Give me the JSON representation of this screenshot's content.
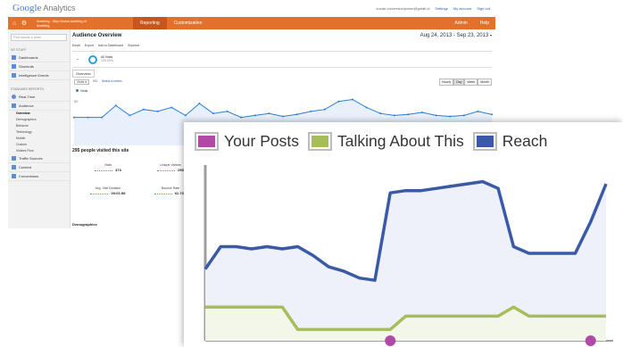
{
  "ga": {
    "logo": {
      "g": "Google",
      "rest": "Analytics"
    },
    "user": {
      "email": "suzan.conversionpower@gmail.nl",
      "settings": "Settings",
      "account": "My account",
      "signout": "Sign out"
    },
    "account": {
      "line1": "Ameling - http://www.ameling.nl",
      "line2": "Ameling"
    },
    "tabs": {
      "reporting": "Reporting",
      "customization": "Customization",
      "admin": "Admin",
      "help": "Help"
    },
    "sidebar": {
      "search": "Find reports & more",
      "my_stuff": "MY STUFF",
      "dashboards": "Dashboards",
      "shortcuts": "Shortcuts",
      "intelligence": "Intelligence Events",
      "standard": "STANDARD REPORTS",
      "realtime": "Real-Time",
      "audience": "Audience",
      "subs": [
        "Overview",
        "Demographics",
        "Behavior",
        "Technology",
        "Mobile",
        "Custom",
        "Visitors Flow"
      ],
      "traffic": "Traffic Sources",
      "content": "Content",
      "conversions": "Conversions"
    },
    "main": {
      "title": "Audience Overview",
      "date_range": "Aug 24, 2013 - Sep 23, 2013",
      "toolbar": [
        "Email",
        "Export",
        "Add to Dashboard",
        "Shortcut"
      ],
      "segment_label": "All Visits",
      "segment_sub": "100.00%",
      "overview_tab": "Overview",
      "metric_select": "Visits",
      "vs": "VS.",
      "select_metric": "Select a metric",
      "ranges": [
        "Hourly",
        "Day",
        "Week",
        "Month"
      ],
      "series_label": "Visits",
      "y_ticks": [
        "50",
        "25"
      ],
      "people": "295 people visited this site",
      "metrics": [
        {
          "label": "Visits",
          "value": "473"
        },
        {
          "label": "Unique Visitors",
          "value": "295"
        },
        {
          "label": "Avg. Visit Duration",
          "value": "00:01:58"
        },
        {
          "label": "Bounce Rate",
          "value": "61.73%"
        }
      ],
      "demographics": "Demographics",
      "visits": [
        28,
        28,
        28,
        40,
        30,
        36,
        34,
        38,
        30,
        42,
        32,
        34,
        28,
        30,
        32,
        29,
        31,
        34,
        36,
        44,
        46,
        38,
        32,
        30,
        31,
        33,
        30,
        29,
        30,
        34,
        31
      ]
    }
  },
  "fb": {
    "legend": [
      {
        "name": "Your Posts",
        "color": "#b04aa6"
      },
      {
        "name": "Talking About This",
        "color": "#a6bd5a"
      },
      {
        "name": "Reach",
        "color": "#3a5aa6"
      }
    ],
    "chart_data": {
      "type": "line",
      "series": [
        {
          "name": "Reach",
          "values": [
            16,
            21,
            21,
            20.5,
            21,
            20.5,
            21,
            19,
            16.5,
            15.5,
            14,
            13.5,
            33,
            33.5,
            33.5,
            34,
            34.5,
            35,
            35.5,
            34,
            21,
            19.5,
            19.5,
            19.5,
            19.5,
            26.5,
            35
          ]
        },
        {
          "name": "Talking About This",
          "values": [
            7.5,
            7.5,
            7.5,
            7.5,
            7.5,
            7.5,
            2.5,
            2.5,
            2.5,
            2.5,
            2.5,
            2.5,
            2.5,
            5.5,
            5.5,
            5.5,
            5.5,
            5.5,
            5.5,
            5.5,
            7.5,
            5.5,
            5.5,
            5.5,
            5.5,
            5.5,
            5.5
          ]
        },
        {
          "name": "Your Posts",
          "values": [
            0,
            0,
            0,
            0,
            0,
            0,
            0,
            0,
            0,
            0,
            0,
            0,
            1,
            0,
            0,
            0,
            0,
            0,
            0,
            0,
            0,
            0,
            0,
            0,
            0,
            1,
            0
          ]
        }
      ],
      "ylim": [
        0,
        40
      ],
      "grid": false,
      "legend_position": "top-left"
    }
  }
}
